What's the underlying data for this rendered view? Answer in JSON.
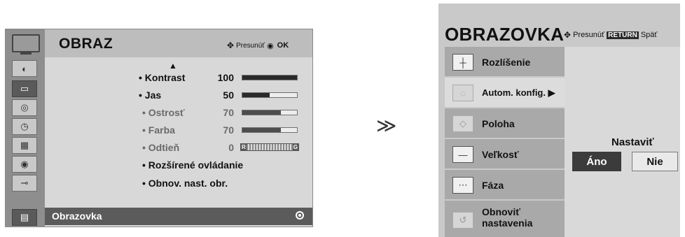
{
  "left_menu": {
    "title": "OBRAZ",
    "nav_hint": {
      "move": "Presunúť",
      "ok": "OK"
    },
    "sidebar_icons": [
      "picture-icon",
      "tv-icon",
      "disc-icon",
      "clock-icon",
      "lock-icon",
      "speaker-icon",
      "plug-icon",
      "film-icon"
    ],
    "rows": [
      {
        "label": "• Kontrast",
        "value": "100",
        "bar": 1.0
      },
      {
        "label": "• Jas",
        "value": "50",
        "bar": 0.5
      },
      {
        "label": "• Ostrosť",
        "value": "70",
        "bar": 0.7
      },
      {
        "label": "• Farba",
        "value": "70",
        "bar": 0.7
      },
      {
        "label": "• Odtieň",
        "value": "0",
        "bar_left": "R",
        "bar_right": "G"
      },
      {
        "label": "• Rozšírené ovládanie"
      },
      {
        "label": "• Obnov. nast. obr."
      }
    ],
    "selected_item": "Obrazovka"
  },
  "right_menu": {
    "title": "OBRAZOVKA",
    "nav_hint": {
      "move": "Presunúť",
      "return_key": "RETURN",
      "back": "Späť"
    },
    "items": [
      {
        "label": "Rozlíšenie",
        "icon": "resolution-icon"
      },
      {
        "label": "Autom. konfig. ▶",
        "icon": "auto-config-icon"
      },
      {
        "label": "Poloha",
        "icon": "position-icon"
      },
      {
        "label": "Veľkosť",
        "icon": "size-icon"
      },
      {
        "label": "Fáza",
        "icon": "phase-icon"
      },
      {
        "label": "Obnoviť nastavenia",
        "icon": "reset-icon"
      }
    ],
    "dialog": {
      "label": "Nastaviť",
      "yes": "Áno",
      "no": "Nie"
    }
  },
  "transition_arrow": "≫"
}
